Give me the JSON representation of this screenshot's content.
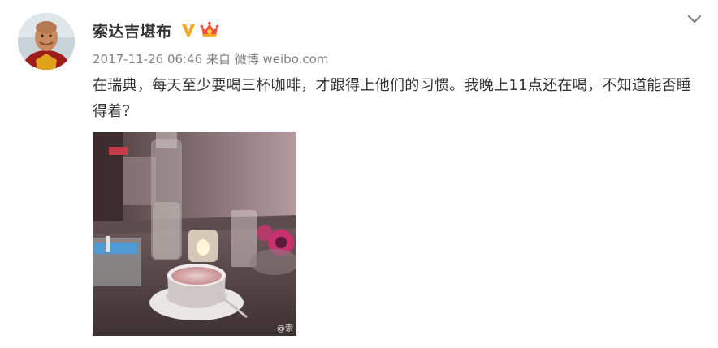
{
  "post": {
    "author": {
      "name": "索达吉堪布",
      "verified_icon": "verified-v-icon",
      "member_icon": "crown-icon"
    },
    "timestamp": "2017-11-26 06:46",
    "source_prefix": "来自",
    "source": "微博 weibo.com",
    "text": "在瑞典，每天至少要喝三杯咖啡，才跟得上他们的习惯。我晚上11点还在喝，不知道能否睡得着？",
    "image": {
      "description_icon": "coffee-photo",
      "watermark": "@索"
    },
    "menu_icon": "chevron-down-icon"
  },
  "colors": {
    "verified": "#f7a923",
    "crown": "#f5503a",
    "meta_text": "#808080",
    "body_text": "#333333"
  }
}
